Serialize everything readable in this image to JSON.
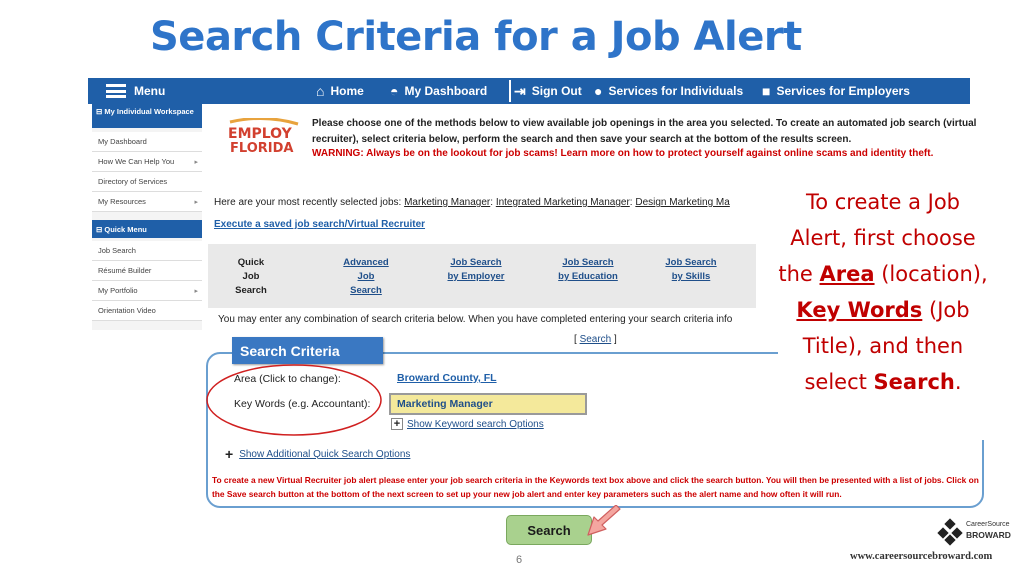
{
  "slide": {
    "title": "Search Criteria for a Job Alert",
    "page_number": "6",
    "website": "www.careersourcebroward.com"
  },
  "brand": {
    "line1": "CareerSource",
    "line2": "BROWARD"
  },
  "navbar": {
    "menu": "Menu",
    "home": "Home",
    "dashboard": "My Dashboard",
    "sign_out": "Sign Out",
    "services_individuals": "Services for Individuals",
    "services_employers": "Services for Employers",
    "color": "#1F5FA8"
  },
  "sidebar": {
    "workspace_header": "⊟ My Individual Workspace",
    "workspace_items": [
      "My Dashboard",
      "How We Can Help You",
      "Directory of Services",
      "My Resources"
    ],
    "quick_header": "⊟ Quick Menu",
    "quick_items": [
      "Job Search",
      "Résumé Builder",
      "My Portfolio",
      "Orientation Video"
    ]
  },
  "logo": {
    "line1": "EMPLOY",
    "line2": "FLORIDA"
  },
  "content": {
    "instructions": "Please choose one of the methods below to view available job openings in the area you selected. To create an automated job search (virtual recruiter), select criteria below, perform the search and then save your search at the bottom of the results screen.",
    "warning": "WARNING: Always be on the lookout for job scams! Learn more on how to protect yourself against online scams and identity theft.",
    "recent_prefix": "Here are your most recently selected jobs: ",
    "recent_jobs": [
      "Marketing Manager",
      "Integrated Marketing Manager",
      "Design Marketing Ma"
    ],
    "saved_search_link": "Execute a saved job search/Virtual Recruiter",
    "tabs": [
      {
        "line1": "Quick",
        "line2": "Job",
        "line3": "Search"
      },
      {
        "line1": "Advanced",
        "line2": "Job",
        "line3": "Search"
      },
      {
        "line1": "Job Search",
        "line2": "by Employer",
        "line3": ""
      },
      {
        "line1": "Job Search",
        "line2": "by Education",
        "line3": ""
      },
      {
        "line1": "Job Search",
        "line2": "by Skills",
        "line3": ""
      }
    ],
    "enter_text": "You may enter any combination of search criteria below. When you have completed entering your search criteria info",
    "search_link_top": "Search"
  },
  "criteria": {
    "tab_label": "Search Criteria",
    "area_label": "Area (Click to change):",
    "area_value": "Broward County, FL",
    "keywords_label": "Key Words (e.g. Accountant):",
    "keywords_value": "Marketing Manager",
    "keyword_options_link": "Show Keyword search Options",
    "additional_link": "Show Additional Quick Search Options",
    "note": "To create a new Virtual Recruiter job alert please enter your job search criteria in the Keywords text box above and click the search button. You will then be presented with a list of jobs.  Click on the Save search button at the bottom of the next screen to set up your new job alert and enter key parameters such as the alert name and how often it will run.",
    "search_button": "Search"
  },
  "callout": {
    "part1": "To create a Job Alert, first choose the",
    "area": "Area",
    "part2": "(location),",
    "keywords": "Key Words",
    "part3": "(Job Title), and then select",
    "search": "Search",
    "end": ".",
    "color": "#C00000"
  }
}
